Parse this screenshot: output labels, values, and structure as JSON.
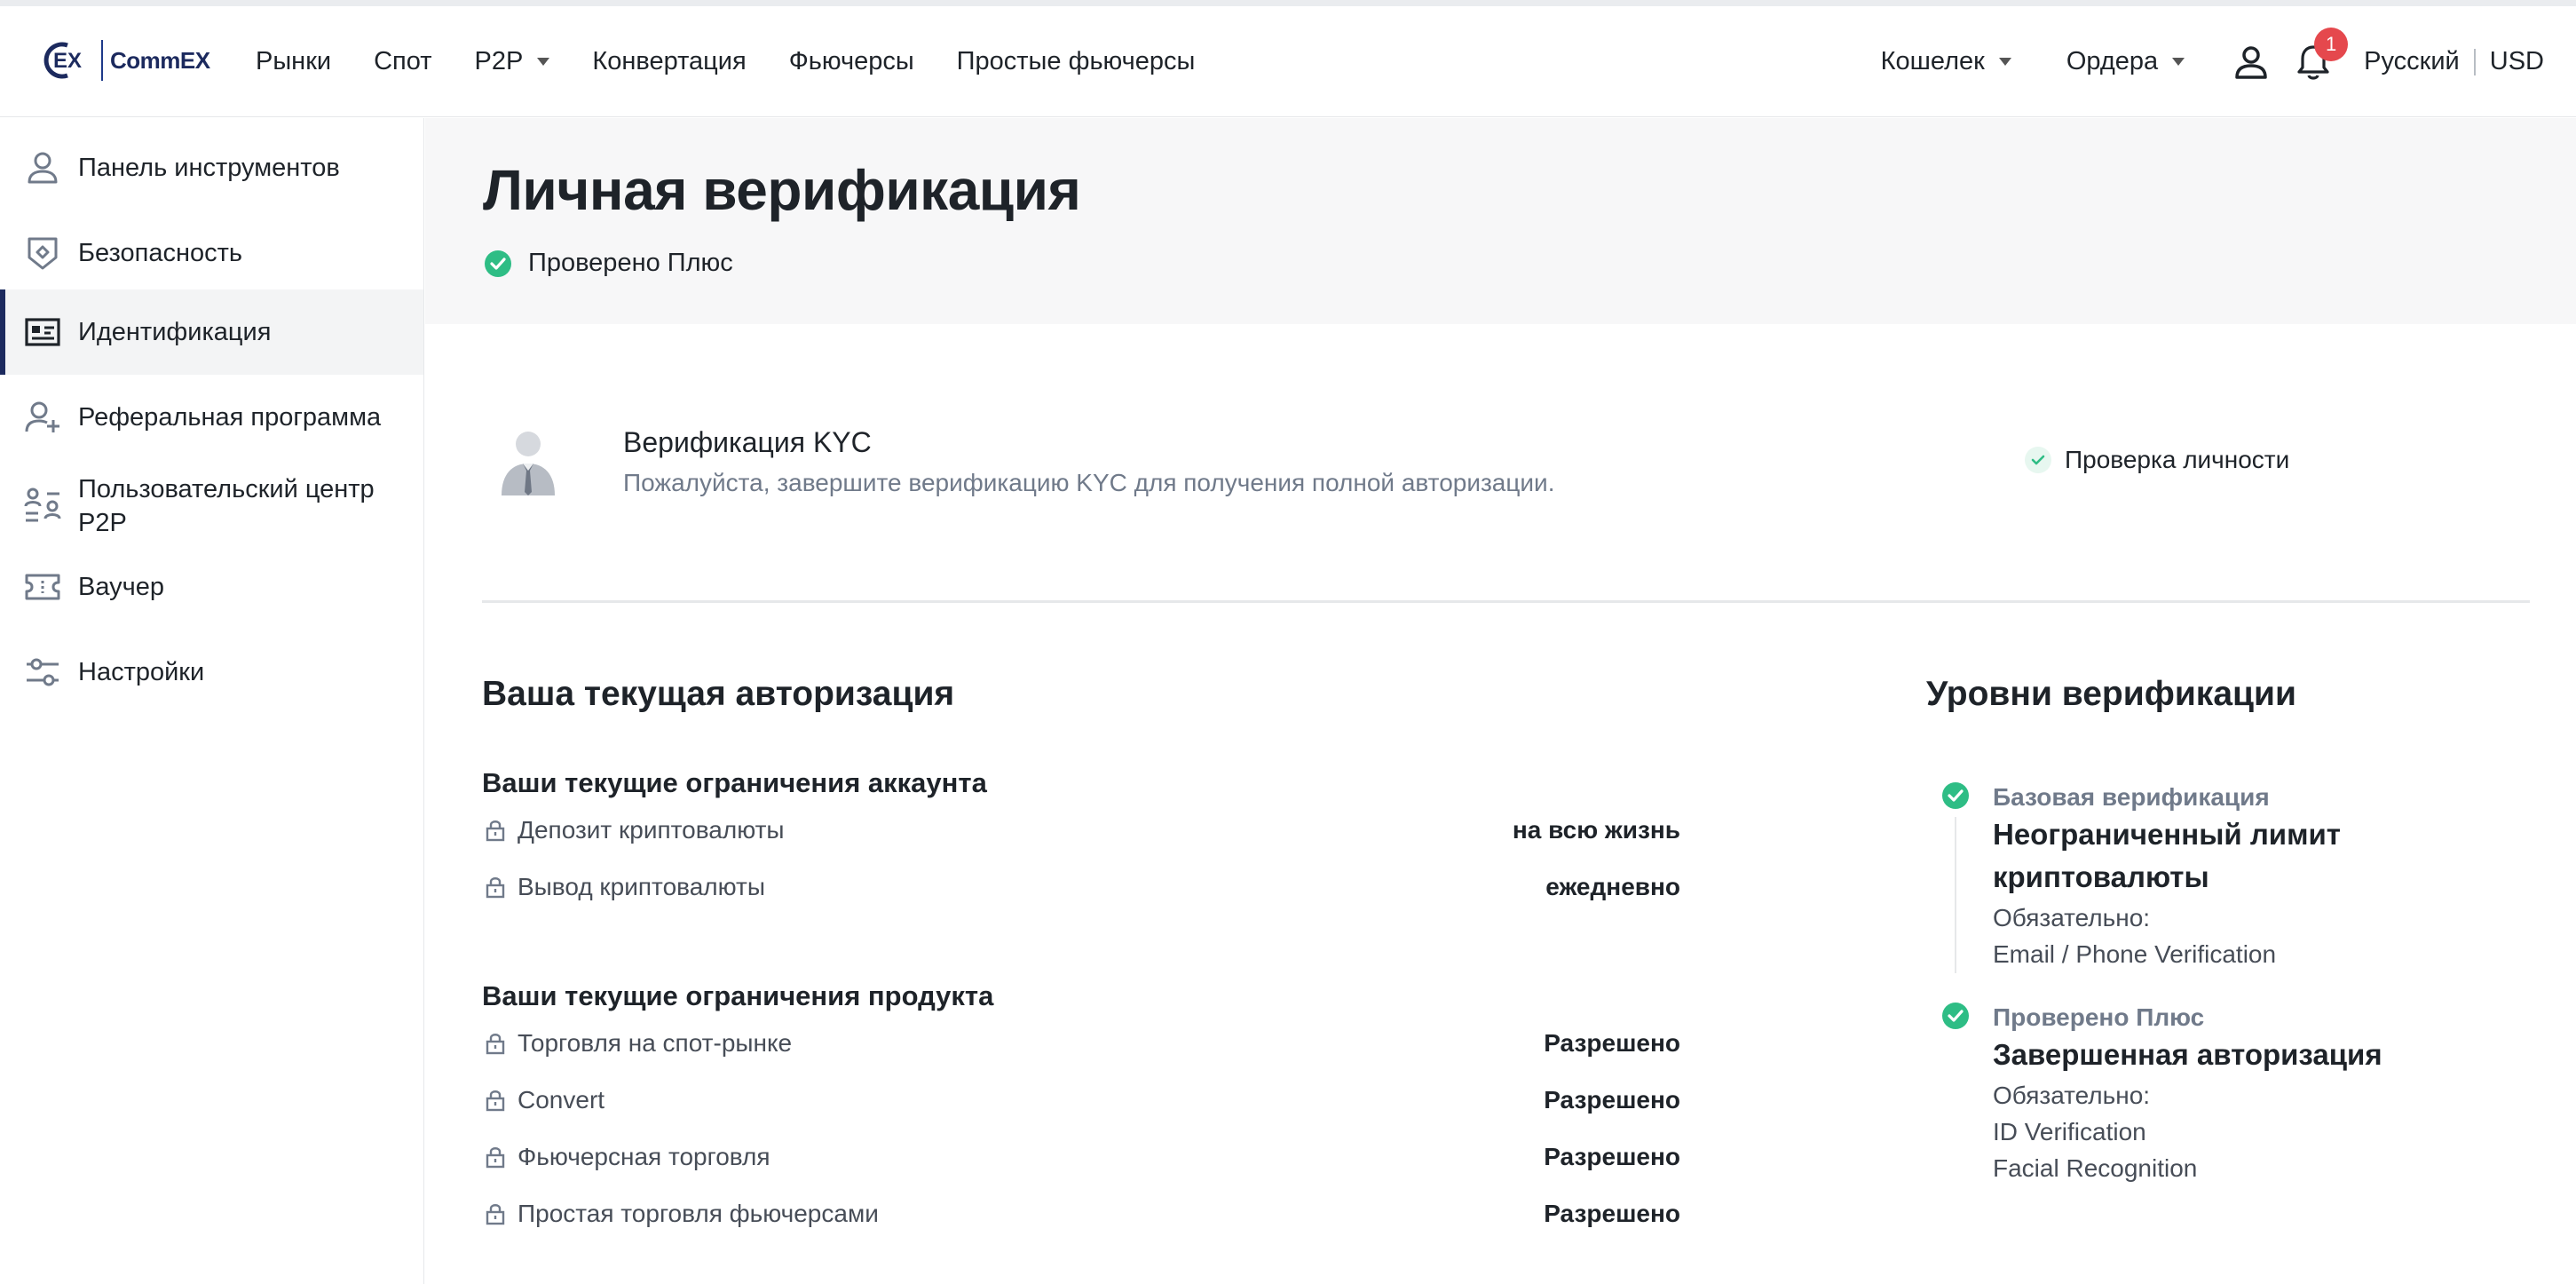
{
  "brand": {
    "name": "CommEX"
  },
  "nav": {
    "markets": "Рынки",
    "spot": "Спот",
    "p2p": "P2P",
    "convert": "Конвертация",
    "futures": "Фьючерсы",
    "simple_futures": "Простые фьючерсы",
    "wallet": "Кошелек",
    "orders": "Ордера",
    "notifications_count": "1",
    "language": "Русский",
    "currency": "USD"
  },
  "sidebar": {
    "items": [
      {
        "label": "Панель инструментов",
        "icon": "user-icon"
      },
      {
        "label": "Безопасность",
        "icon": "shield-icon"
      },
      {
        "label": "Идентификация",
        "icon": "id-card-icon",
        "active": true
      },
      {
        "label": "Реферальная программа",
        "icon": "user-plus-icon"
      },
      {
        "label": "Пользовательский центр P2P",
        "icon": "p2p-users-icon"
      },
      {
        "label": "Ваучер",
        "icon": "voucher-icon"
      },
      {
        "label": "Настройки",
        "icon": "settings-sliders-icon"
      }
    ]
  },
  "page": {
    "title": "Личная верификация",
    "status": "Проверено Плюс"
  },
  "kyc": {
    "title": "Верификация KYC",
    "description": "Пожалуйста, завершите верификацию KYC для получения полной авторизации.",
    "check_label": "Проверка личности"
  },
  "authorization": {
    "title": "Ваша текущая авторизация",
    "account_limits_title": "Ваши текущие ограничения аккаунта",
    "account_limits": [
      {
        "label": "Депозит криптовалюты",
        "value": "на всю жизнь"
      },
      {
        "label": "Вывод криптовалюты",
        "value": "ежедневно"
      }
    ],
    "product_limits_title": "Ваши текущие ограничения продукта",
    "product_limits": [
      {
        "label": "Торговля на спот-рынке",
        "value": "Разрешено"
      },
      {
        "label": "Convert",
        "value": "Разрешено"
      },
      {
        "label": "Фьючерсная торговля",
        "value": "Разрешено"
      },
      {
        "label": "Простая торговля фьючерсами",
        "value": "Разрешено"
      }
    ]
  },
  "levels": {
    "title": "Уровни верификации",
    "items": [
      {
        "name": "Базовая верификация",
        "headline_1": "Неограниченный лимит",
        "headline_2": "криптовалюты",
        "required_label": "Обязательно:",
        "requirements": [
          "Email / Phone Verification"
        ]
      },
      {
        "name": "Проверено Плюс",
        "headline_1": "Завершенная авторизация",
        "required_label": "Обязательно:",
        "requirements": [
          "ID Verification",
          "Facial Recognition"
        ]
      }
    ]
  },
  "colors": {
    "brand": "#1c2a5e",
    "success": "#2ebd85",
    "badge": "#e5484d"
  }
}
